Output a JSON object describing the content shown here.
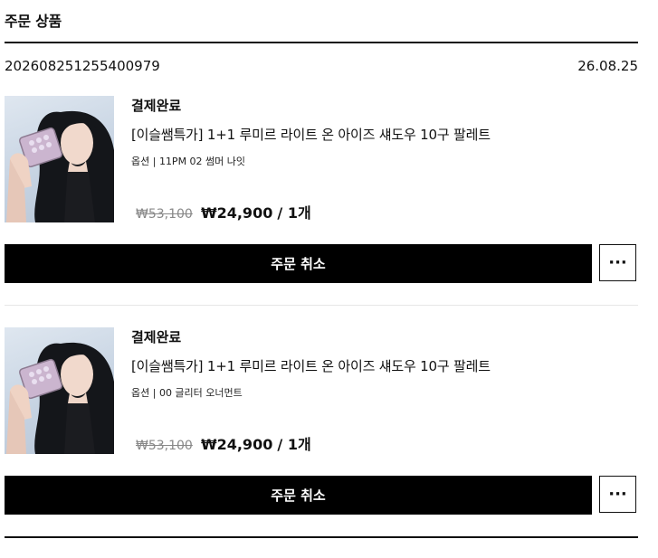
{
  "section": {
    "title": "주문 상품"
  },
  "order": {
    "number": "202608251255400979",
    "date": "26.08.25"
  },
  "items": [
    {
      "status": "결제완료",
      "name": "[이슬쌤특가] 1+1 루미르 라이트 온 아이즈 섀도우 10구 팔레트",
      "option": "옵션 | 11PM 02 썸머 나잇",
      "price_original": "₩53,100",
      "price_sale": "₩24,900",
      "quantity": "/ 1개",
      "cancel_label": "주문 취소",
      "more_label": "···",
      "thumbnail_icon": "product-photo"
    },
    {
      "status": "결제완료",
      "name": "[이슬쌤특가] 1+1 루미르 라이트 온 아이즈 섀도우 10구 팔레트",
      "option": "옵션 | 00 글리터 오너먼트",
      "price_original": "₩53,100",
      "price_sale": "₩24,900",
      "quantity": "/ 1개",
      "cancel_label": "주문 취소",
      "more_label": "···",
      "thumbnail_icon": "product-photo"
    }
  ],
  "colors": {
    "primary_button": "#000000",
    "text": "#111111",
    "muted": "#888888"
  }
}
